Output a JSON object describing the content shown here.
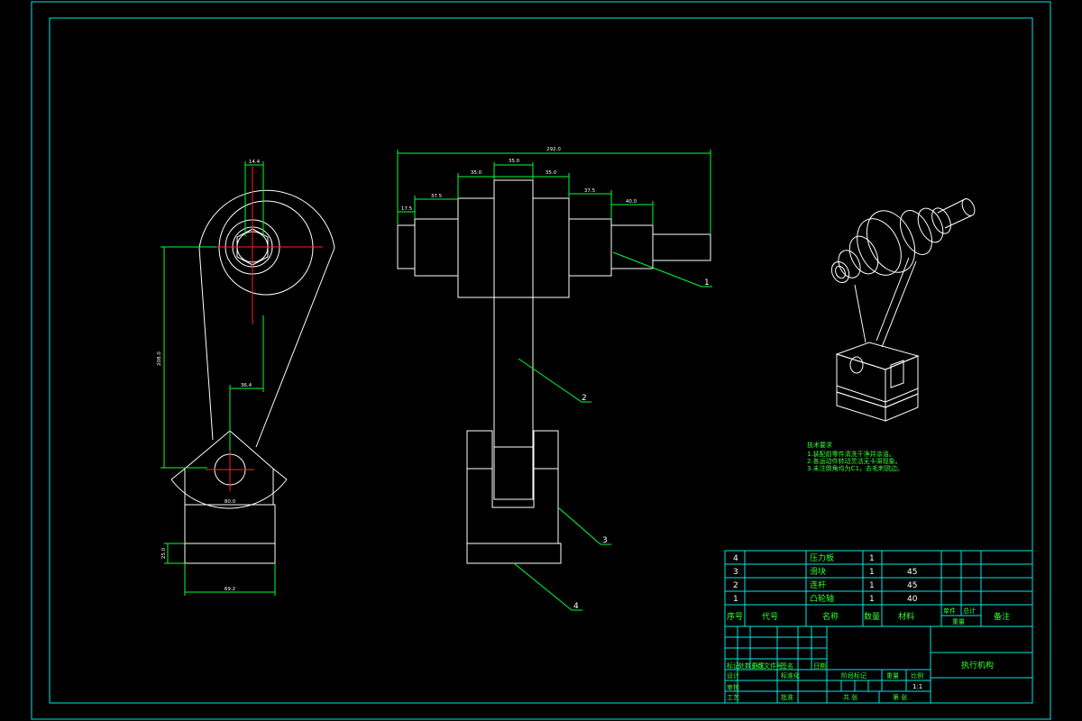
{
  "drawing": {
    "title": "执行机构",
    "front_view_dims": {
      "top_width": "14.4",
      "height": "208.0",
      "offset": "36.4",
      "arc_width": "80.0",
      "base_height": "25.0",
      "base_width": "69.2"
    },
    "side_view_dims": {
      "overall": "292.0",
      "d1": "17.5",
      "d2": "37.5",
      "d3": "35.0",
      "d4": "35.0",
      "d5": "35.0",
      "d6": "37.5",
      "d7": "40.0"
    },
    "balloons": [
      "1",
      "2",
      "3",
      "4"
    ],
    "tech_notes": {
      "heading": "技术要求",
      "lines": [
        "1.装配前零件清洗干净并涂油。",
        "2.各运动件转动灵活无卡滞现象。",
        "3.未注倒角均为C1，去毛刺锐边。"
      ]
    },
    "bom": {
      "rows": [
        {
          "no": "4",
          "code": "",
          "name": "压力板",
          "qty": "1",
          "material": "",
          "w1": "",
          "w2": "",
          "note": ""
        },
        {
          "no": "3",
          "code": "",
          "name": "滑块",
          "qty": "1",
          "material": "45",
          "w1": "",
          "w2": "",
          "note": ""
        },
        {
          "no": "2",
          "code": "",
          "name": "连杆",
          "qty": "1",
          "material": "45",
          "w1": "",
          "w2": "",
          "note": ""
        },
        {
          "no": "1",
          "code": "",
          "name": "凸轮轴",
          "qty": "1",
          "material": "40",
          "w1": "",
          "w2": "",
          "note": ""
        }
      ],
      "header": {
        "no": "序号",
        "code": "代号",
        "name": "名称",
        "qty": "数量",
        "material": "材料",
        "single": "单件",
        "total": "总计",
        "weight": "重量",
        "note": "备注"
      }
    },
    "title_block": {
      "labels": {
        "mark": "标记",
        "count": "处数",
        "zone": "分区",
        "change_doc": "更改文件号",
        "sign": "签名",
        "date": "日期",
        "design": "设计",
        "standard": "标准化",
        "stage_mark": "阶段标记",
        "weight": "重量",
        "scale": "比例",
        "review": "审核",
        "process": "工艺",
        "approve": "批准",
        "sheets_total": "共 张",
        "sheet_no": "第 张"
      },
      "scale_value": "1:1"
    },
    "colors": {
      "background": "#000000",
      "frame": "#00e6e6",
      "geometry": "#ffffff",
      "dimensions": "#00ff33",
      "centerlines": "#ff2020"
    }
  }
}
